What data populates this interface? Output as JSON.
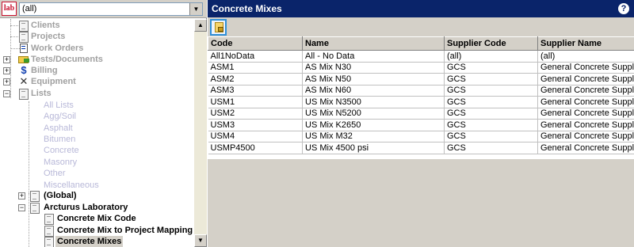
{
  "logo": {
    "text": "lab"
  },
  "filter": {
    "value": "(all)"
  },
  "tree": {
    "nodes": [
      {
        "label": "Clients"
      },
      {
        "label": "Projects"
      },
      {
        "label": "Work Orders"
      },
      {
        "label": "Tests/Documents"
      },
      {
        "label": "Billing"
      },
      {
        "label": "Equipment"
      },
      {
        "label": "Lists"
      },
      {
        "label": "All Lists"
      },
      {
        "label": "Agg/Soil"
      },
      {
        "label": "Asphalt"
      },
      {
        "label": "Bitumen"
      },
      {
        "label": "Concrete"
      },
      {
        "label": "Masonry"
      },
      {
        "label": "Other"
      },
      {
        "label": "Miscellaneous"
      },
      {
        "label": "(Global)"
      },
      {
        "label": "Arcturus Laboratory"
      },
      {
        "label": "Concrete Mix Code"
      },
      {
        "label": "Concrete Mix to Project Mapping"
      },
      {
        "label": "Concrete Mixes"
      }
    ]
  },
  "panel": {
    "title": "Concrete Mixes",
    "help_label": "?"
  },
  "grid": {
    "columns": [
      "Code",
      "Name",
      "Supplier Code",
      "Supplier Name"
    ],
    "rows": [
      [
        "All1NoData",
        "All - No Data",
        "(all)",
        "(all)"
      ],
      [
        "ASM1",
        "AS Mix N30",
        "GCS",
        "General Concrete Supplier"
      ],
      [
        "ASM2",
        "AS Mix N50",
        "GCS",
        "General Concrete Supplier"
      ],
      [
        "ASM3",
        "AS Mix N60",
        "GCS",
        "General Concrete Supplier"
      ],
      [
        "USM1",
        "US Mix N3500",
        "GCS",
        "General Concrete Supplier"
      ],
      [
        "USM2",
        "US Mix N5200",
        "GCS",
        "General Concrete Supplier"
      ],
      [
        "USM3",
        "US Mix K2650",
        "GCS",
        "General Concrete Supplier"
      ],
      [
        "USM4",
        "US Mix M32",
        "GCS",
        "General Concrete Supplier"
      ],
      [
        "USMP4500",
        "US Mix 4500 psi",
        "GCS",
        "General Concrete Supplier"
      ]
    ]
  },
  "colors": {
    "title_bar": "#0a246a",
    "selection": "#d4d0c8",
    "toolbar_highlight": "#2f8fd8"
  }
}
